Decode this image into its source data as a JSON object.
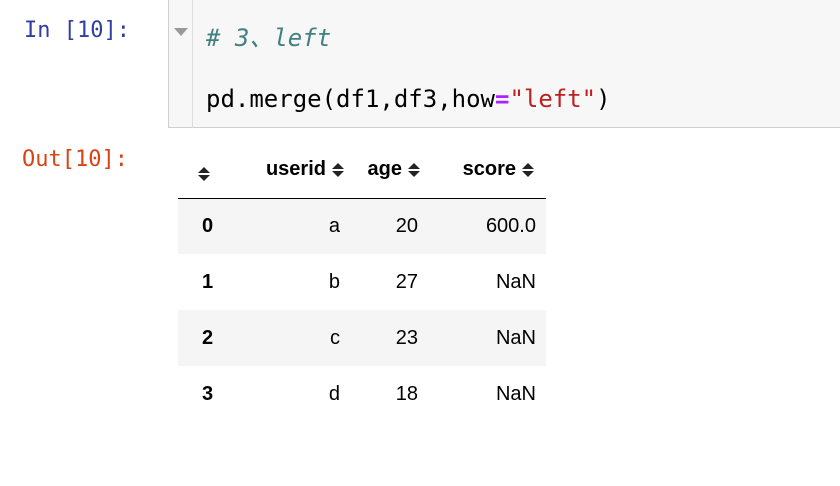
{
  "cell": {
    "in_prompt": "In [10]:",
    "out_prompt": "Out[10]:",
    "code": {
      "comment": "# 3、left",
      "call_prefix": "pd.merge(df1,df3,how",
      "equals": "=",
      "string": "\"left\"",
      "call_suffix": ")"
    }
  },
  "table": {
    "columns": [
      "userid",
      "age",
      "score"
    ],
    "rows": [
      {
        "index": "0",
        "userid": "a",
        "age": "20",
        "score": "600.0"
      },
      {
        "index": "1",
        "userid": "b",
        "age": "27",
        "score": "NaN"
      },
      {
        "index": "2",
        "userid": "c",
        "age": "23",
        "score": "NaN"
      },
      {
        "index": "3",
        "userid": "d",
        "age": "18",
        "score": "NaN"
      }
    ]
  },
  "colors": {
    "in_prompt": "#303f9f",
    "out_prompt": "#d84315",
    "comment": "#408080",
    "keyword_op": "#aa22ff",
    "string": "#ba2121",
    "row_stripe": "#f5f5f5"
  },
  "icons": {
    "fold": "triangle-down-icon",
    "sort": "sort-arrows-icon"
  }
}
